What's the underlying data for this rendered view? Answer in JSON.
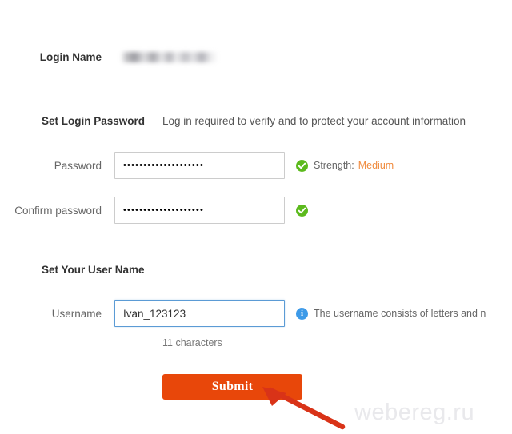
{
  "form": {
    "login_name": {
      "label": "Login Name",
      "value_redacted": true
    },
    "set_login_password": {
      "heading": "Set Login Password",
      "description": "Log in required to verify and to protect your account information"
    },
    "password": {
      "label": "Password",
      "value": "••••••••••••••••••••",
      "status_icon": "check-circle-icon",
      "strength_label": "Strength:",
      "strength_value": "Medium",
      "strength_color": "#f08a3c"
    },
    "confirm_password": {
      "label": "Confirm password",
      "value": "••••••••••••••••••••",
      "status_icon": "check-circle-icon"
    },
    "set_user_name": {
      "heading": "Set Your User Name"
    },
    "username": {
      "label": "Username",
      "value": "Ivan_123123",
      "placeholder": "",
      "hint_icon": "info-circle-icon",
      "hint": "The username consists of letters and n",
      "char_count": "11 characters",
      "focused": true
    },
    "submit": {
      "label": "Submit",
      "color": "#e8470a"
    }
  },
  "annotation": {
    "arrow_color": "#d93318"
  },
  "watermark": {
    "text": "webereg.ru"
  },
  "icons": {
    "info_glyph": "i"
  }
}
